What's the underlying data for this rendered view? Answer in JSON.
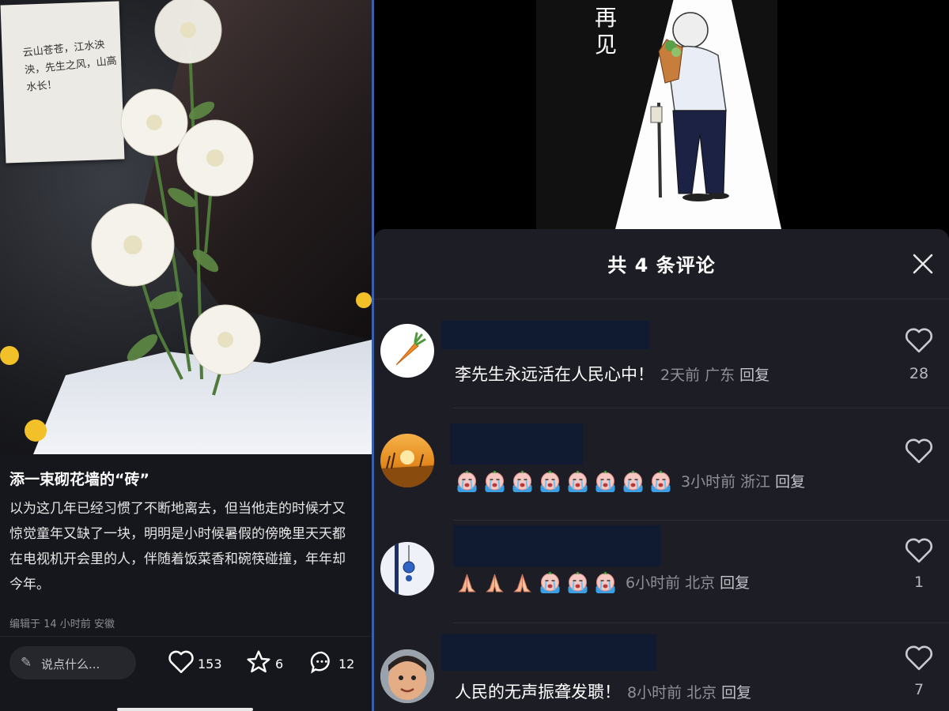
{
  "left_post": {
    "note_text": "云山苍苍，江水泱泱，先生之风，山高水长！",
    "title": "添一束砌花墙的“砖”",
    "body": "以为这几年已经习惯了不断地离去，但当他走的时候才又惊觉童年又缺了一块，明明是小时候暑假的傍晚里天天都在电视机开会里的人，伴随着饭菜香和碗筷碰撞，年年却今年。",
    "meta": "编辑于 14 小时前 安徽",
    "input_placeholder": "说点什么...",
    "likes": "153",
    "favorites": "6",
    "comments": "12"
  },
  "cartoon": {
    "caption": "再见"
  },
  "comments_panel": {
    "title": "共 4 条评论",
    "comments": [
      {
        "text": "李先生永远活在人民心中！",
        "time": "2天前",
        "location": "广东",
        "reply": "回复",
        "likes": "28",
        "avatar_icon": "carrot-icon"
      },
      {
        "text": "",
        "emoji": [
          "crying-emoji",
          "crying-emoji",
          "crying-emoji",
          "crying-emoji",
          "crying-emoji",
          "crying-emoji",
          "crying-emoji",
          "crying-emoji"
        ],
        "time": "3小时前",
        "location": "浙江",
        "reply": "回复",
        "likes": "",
        "avatar_icon": "sunset-icon"
      },
      {
        "text": "",
        "emoji": [
          "praying-hands-emoji",
          "praying-hands-emoji",
          "praying-hands-emoji",
          "crying-emoji",
          "crying-emoji",
          "crying-emoji"
        ],
        "time": "6小时前",
        "location": "北京",
        "reply": "回复",
        "likes": "1",
        "avatar_icon": "charm-icon"
      },
      {
        "text": "人民的无声振聋发聩！",
        "time": "8小时前",
        "location": "北京",
        "reply": "回复",
        "likes": "7",
        "avatar_icon": "child-photo-icon"
      }
    ]
  },
  "colors": {
    "panel_bg": "#1d1d25",
    "left_bg": "#16171c",
    "meta_gray": "#8f9098",
    "redaction": "#101a31"
  }
}
